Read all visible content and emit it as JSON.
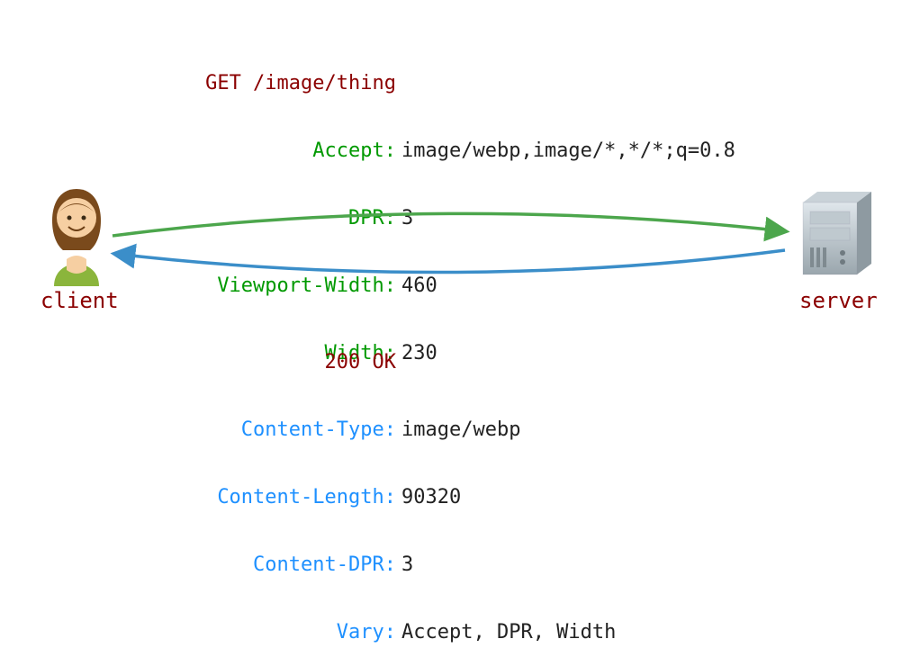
{
  "request": {
    "line": "GET /image/thing",
    "headers": [
      {
        "name": "Accept",
        "value": "image/webp,image/*,*/*;q=0.8"
      },
      {
        "name": "DPR",
        "value": "3"
      },
      {
        "name": "Viewport-Width",
        "value": "460"
      },
      {
        "name": "Width",
        "value": "230"
      }
    ]
  },
  "response": {
    "line": "200 OK",
    "headers": [
      {
        "name": "Content-Type",
        "value": "image/webp"
      },
      {
        "name": "Content-Length",
        "value": "90320"
      },
      {
        "name": "Content-DPR",
        "value": "3"
      },
      {
        "name": "Vary",
        "value": "Accept, DPR, Width"
      }
    ]
  },
  "client_label": "client",
  "server_label": "server",
  "colors": {
    "request_header": "#009900",
    "response_header": "#1e90ff",
    "status_line": "#8b0000",
    "arrow_request": "#4ca64c",
    "arrow_response": "#3b8ec9"
  }
}
